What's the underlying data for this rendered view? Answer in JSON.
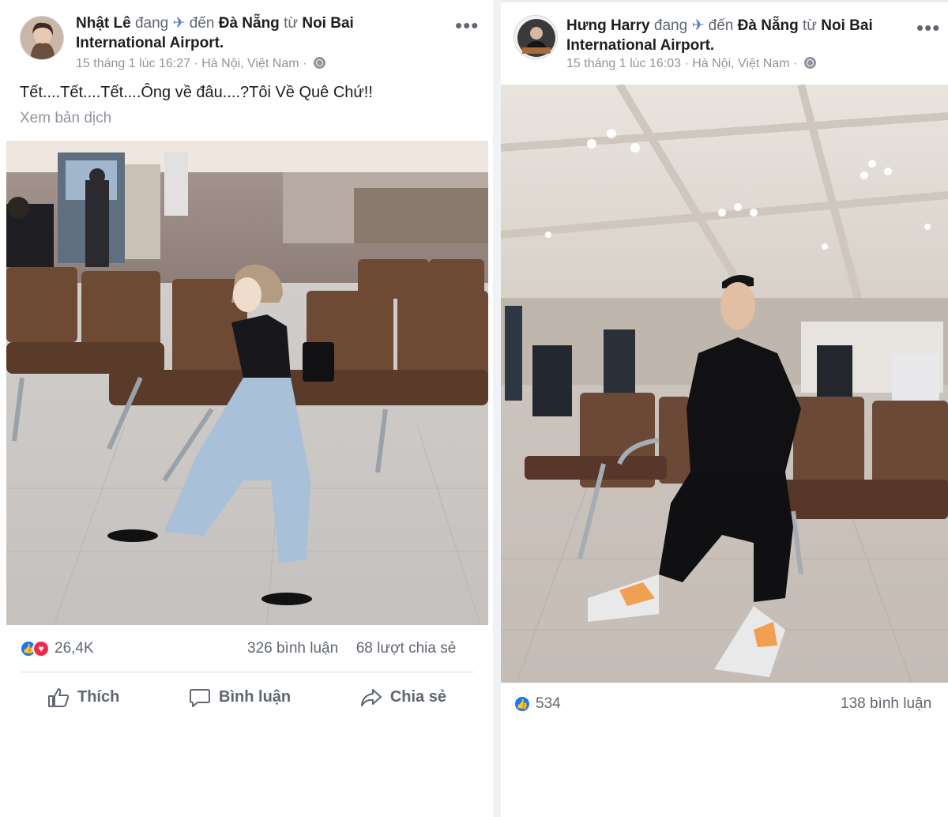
{
  "left_post": {
    "author": "Nhật Lê",
    "verb": "đang",
    "travel_icon": "airplane-icon",
    "to_word": "đến",
    "destination": "Đà Nẵng",
    "from_word": "từ",
    "origin": "Noi Bai International Airport.",
    "origin_line1": "Noi Bai",
    "origin_line2": "International Airport.",
    "timestamp": "15 tháng 1 lúc 16:27",
    "location": "Hà Nội, Việt Nam",
    "privacy_icon": "globe-icon",
    "caption": "Tết....Tết....Tết....Ông về đâu....?Tôi Về Quê Chứ!!",
    "translate_label": "Xem bản dịch",
    "reaction_count": "26,4K",
    "comments": "326 bình luận",
    "shares": "68 lượt chia sẻ",
    "actions": {
      "like": "Thích",
      "comment": "Bình luận",
      "share": "Chia sẻ"
    }
  },
  "right_post": {
    "author": "Hưng Harry",
    "verb": "đang",
    "travel_icon": "airplane-icon",
    "to_word": "đến",
    "destination": "Đà Nẵng",
    "from_word": "từ",
    "origin_line1": "Noi Bai",
    "origin_line2": "International Airport.",
    "timestamp": "15 tháng 1 lúc 16:03",
    "location": "Hà Nội, Việt Nam",
    "privacy_icon": "globe-icon",
    "reaction_count": "534",
    "comments": "138 bình luận"
  },
  "colors": {
    "accent": "#1877f2",
    "love": "#f0284a",
    "muted": "#90949c",
    "text": "#1c1e21"
  }
}
